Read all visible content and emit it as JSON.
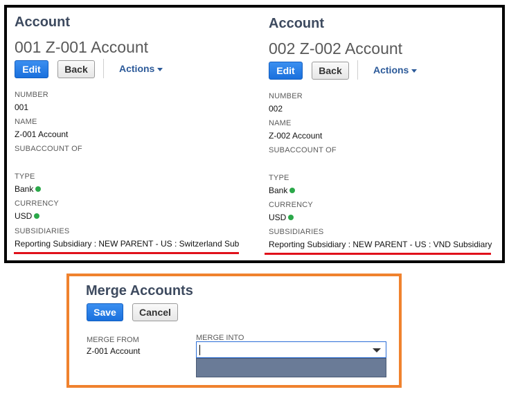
{
  "panels": [
    {
      "heading": "Account",
      "title": "001 Z-001 Account",
      "edit_label": "Edit",
      "back_label": "Back",
      "actions_label": "Actions",
      "fields": {
        "number_label": "NUMBER",
        "number_value": "001",
        "name_label": "NAME",
        "name_value": "Z-001 Account",
        "subaccount_label": "SUBACCOUNT OF",
        "subaccount_value": "",
        "type_label": "TYPE",
        "type_value": "Bank",
        "currency_label": "CURRENCY",
        "currency_value": "USD",
        "subsidiaries_label": "SUBSIDIARIES",
        "subsidiaries_value": "Reporting Subsidiary : NEW PARENT - US : Switzerland Sub"
      }
    },
    {
      "heading": "Account",
      "title": "002 Z-002 Account",
      "edit_label": "Edit",
      "back_label": "Back",
      "actions_label": "Actions",
      "fields": {
        "number_label": "NUMBER",
        "number_value": "002",
        "name_label": "NAME",
        "name_value": "Z-002 Account",
        "subaccount_label": "SUBACCOUNT OF",
        "subaccount_value": "",
        "type_label": "TYPE",
        "type_value": "Bank",
        "currency_label": "CURRENCY",
        "currency_value": "USD",
        "subsidiaries_label": "SUBSIDIARIES",
        "subsidiaries_value": "Reporting Subsidiary : NEW PARENT - US : VND Subsidiary"
      }
    }
  ],
  "status_dot_color": "#2ba84a",
  "highlight_colors": {
    "compare_border": "#000000",
    "merge_border": "#f0822e",
    "underline": "#e0101a"
  },
  "merge": {
    "title": "Merge Accounts",
    "save_label": "Save",
    "cancel_label": "Cancel",
    "merge_from_label": "MERGE FROM",
    "merge_from_value": "Z-001 Account",
    "merge_into_label": "MERGE INTO",
    "merge_into_value": ""
  }
}
